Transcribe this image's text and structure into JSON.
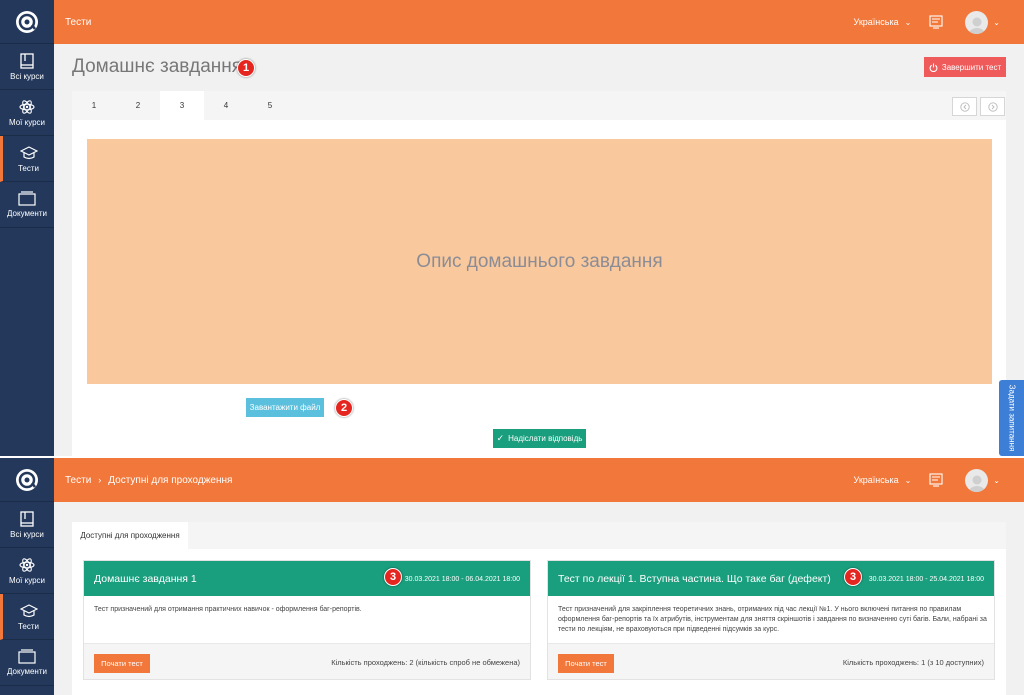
{
  "sidebar": {
    "items": [
      {
        "label": "Всі курси",
        "icon": "book-icon"
      },
      {
        "label": "Мої курси",
        "icon": "atom-icon"
      },
      {
        "label": "Тести",
        "icon": "graduation-cap-icon"
      },
      {
        "label": "Документи",
        "icon": "folder-icon"
      }
    ]
  },
  "screen1": {
    "breadcrumb": "Тести",
    "language": "Українська",
    "title": "Домашнє завдання",
    "finish_label": "Завершити тест",
    "tabs": [
      "1",
      "2",
      "3",
      "4",
      "5"
    ],
    "active_tab": "3",
    "description": "Опис домашнього завдання",
    "upload_label": "Завантажити файл",
    "send_label": "Надіслати відповідь",
    "side_tab_label": "Задати запитання",
    "markers": [
      "1",
      "2"
    ]
  },
  "screen2": {
    "breadcrumb_root": "Тести",
    "breadcrumb_sep": "›",
    "breadcrumb_current": "Доступні для проходження",
    "language": "Українська",
    "tab_label": "Доступні для проходження",
    "cards": [
      {
        "title": "Домашнє завдання 1",
        "marker": "3",
        "dates": "30.03.2021 18:00 - 06.04.2021 18:00",
        "description": "Тест призначений для отримання практичних навичок - оформлення баг-репортів.",
        "start_label": "Почати тест",
        "attempts": "Кількість проходжень: 2 (кількість спроб не обмежена)"
      },
      {
        "title": "Тест по лекції 1. Вступна частина. Що таке баг (дефект)",
        "marker": "3",
        "dates": "30.03.2021 18:00 - 25.04.2021 18:00",
        "description": "Тест призначений для закріплення теоретичних знань, отриманих під час лекції №1. У нього включені питання по правилам оформлення баг-репортів та їх атрибутів, інструментам для зняття скріншотів і завдання по визначенню суті багів. Бали, набрані за тести по лекціям, не враховуються при підведенні підсумків за курс.",
        "start_label": "Почати тест",
        "attempts": "Кількість проходжень: 1 (з 10 доступних)"
      }
    ]
  },
  "colors": {
    "sidebar": "#23385b",
    "topbar": "#f2773a",
    "accent_green": "#1a9f7e",
    "description_bg": "#f9c99d",
    "finish_red": "#ef5a5a",
    "upload_blue": "#5bc0de",
    "marker_red": "#e52620"
  }
}
